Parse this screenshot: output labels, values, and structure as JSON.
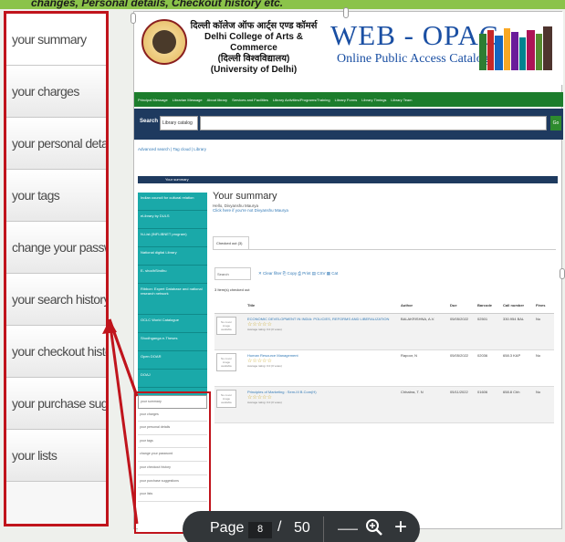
{
  "caption": "changes, Personal details, Checkout history etc.",
  "zoom_panel": {
    "items": [
      "your summary",
      "your charges",
      "your personal details",
      "your tags",
      "change your password",
      "your search history",
      "your checkout history",
      "your purchase suggestions",
      "your lists"
    ]
  },
  "header": {
    "college_hindi": "दिल्ली कॉलेज ऑफ आर्ट्स एण्ड कॉमर्स",
    "college_english": "Delhi College of Arts & Commerce",
    "university_hindi": "(दिल्ली विश्वविद्यालय)",
    "university_english": "(University of Delhi)",
    "opac_title": "WEB - OPAC",
    "opac_subtitle": "Online Public Access Catalog"
  },
  "nav": [
    "Principal Message",
    "Librarian Message",
    "About library",
    "Services and Facilities",
    "Library Activities/Programs/Training",
    "Library Forms",
    "Library Timings",
    "Library Team"
  ],
  "search": {
    "label": "Search",
    "select": "Library catalog",
    "go": "Go"
  },
  "advanced": "Advanced search | Tag cloud | Library",
  "breadcrumb": "Your summary",
  "left_links": [
    "Indian council for cultural relation",
    "eLibrary by DULS",
    "N-List (INFLIBNET program)",
    "National digital Library",
    "E- shodhSindhu",
    "Ribbon: Expert Database and national research network",
    "OCLC World Catalogue",
    "Shodhganga e-Theses",
    "Open DOAR",
    "DOAJ"
  ],
  "sub_menu": [
    "your summary",
    "your charges",
    "your personal details",
    "your tags",
    "change your password",
    "your checkout history",
    "your purchase suggestions",
    "your lists"
  ],
  "main": {
    "heading": "Your summary",
    "hello": "Hello, Divyanshu Maurya",
    "not_you": "Click here if you're not Divyanshu Maurya",
    "tab": "Checked out (3)",
    "search_placeholder": "Search",
    "toolbar": "✕ Clear filter   ⎘ Copy   ⎙ Print   ▤ CSV   ▦ Cat",
    "count": "3 Item(s) checked out",
    "columns": [
      "",
      "Title",
      "Author",
      "Due",
      "Barcode",
      "Call number",
      "Fines"
    ],
    "rows": [
      {
        "cover": "No cover image available",
        "title": "ECONOMIC DEVELOPMENT IN INDIA: POLICIES, REFORMS AND LIBERALIZATION",
        "author": "BALAKRISHNA, A.V.",
        "due": "05/05/2022",
        "barcode": "02501",
        "call": "330.954 BAL",
        "fines": "No"
      },
      {
        "cover": "No cover image available",
        "title": "Human Resource Management",
        "author": "Rapoor, N",
        "due": "05/05/2022",
        "barcode": "02036",
        "call": "658.3 KAP",
        "fines": "No"
      },
      {
        "cover": "No cover image available",
        "title": "Principles of Marketing : Sem-III B.Com(H)",
        "author": "Chhabra, T. N",
        "due": "05/11/2022",
        "barcode": "01606",
        "call": "658.8 Chh",
        "fines": "No"
      }
    ],
    "rating": "☆☆☆☆☆",
    "avg": "Average rating: 0.0 (0 votes)"
  },
  "pager": {
    "label": "Page",
    "current": "8",
    "sep": "/",
    "total": "50",
    "minus": "—",
    "plus": "+"
  }
}
